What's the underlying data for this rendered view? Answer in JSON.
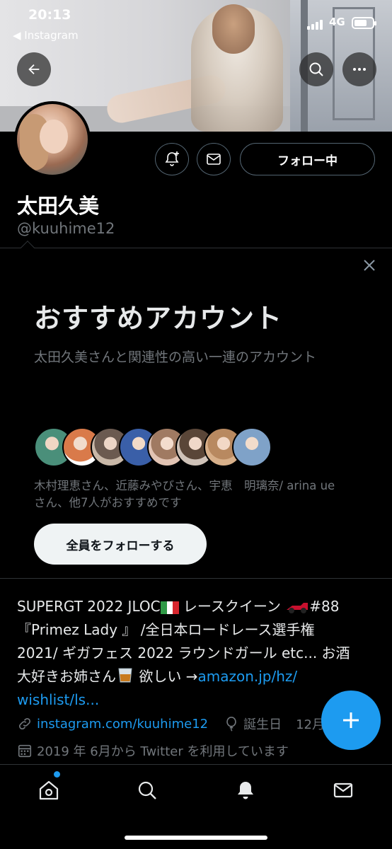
{
  "status_bar": {
    "time": "20:13",
    "back_app": "◀ Instagram",
    "network": "4G"
  },
  "header": {
    "back_icon": "back-arrow-icon",
    "search_icon": "search-icon",
    "more_icon": "more-dots-icon"
  },
  "profile": {
    "display_name": "太田久美",
    "handle": "@kuuhime12",
    "follow_label": "フォロー中"
  },
  "recommendation": {
    "title": "おすすめアカウント",
    "description": "太田久美さんと関連性の高い一連のアカウント",
    "names_text": "木村理恵さん、近藤みやびさん、宇恵　明璃奈/ arina ueさん、他7人がおすすめです",
    "follow_all_label": "全員をフォローする",
    "avatar_colors": [
      "#4a8f7a",
      "#d97a4a",
      "#c9b8a8",
      "#3a5fa8",
      "#e2c4b4",
      "#cfc2b8",
      "#d8b08a",
      "#7fa2c8"
    ]
  },
  "bio": {
    "line1_pre": "SUPERGT 2022 JLOC",
    "line1_mid": " レースクイーン ",
    "line1_post": "#88",
    "line2": "『Primez Lady 』 /全日本ロードレース選手権",
    "line3": "2021/ ギガフェス 2022 ラウンドガール etc... お酒",
    "line4_pre": "大好きお姉さん",
    "line4_mid": " 欲しい →",
    "link_part1": "amazon.jp/hz/",
    "link_part2": "wishlist/ls..."
  },
  "meta": {
    "website": "instagram.com/kuuhime12",
    "birthday_label": "誕生日",
    "birthday_value": "12月",
    "joined": "2019 年 6月から Twitter を利用しています"
  },
  "colors": {
    "accent": "#1d9bf0",
    "muted": "#71767b",
    "border": "#2f3336"
  }
}
